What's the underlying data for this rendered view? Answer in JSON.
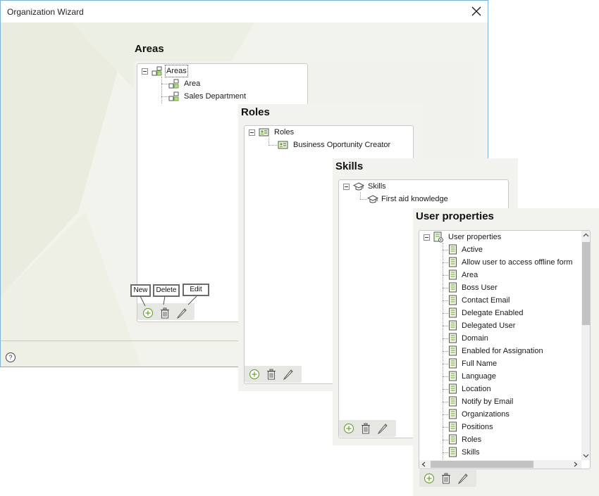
{
  "window": {
    "title": "Organization Wizard"
  },
  "areas": {
    "title": "Areas",
    "tree": {
      "root": "Areas",
      "children": [
        "Area",
        "Sales Department"
      ]
    }
  },
  "roles": {
    "title": "Roles",
    "tree": {
      "root": "Roles",
      "children": [
        "Business Oportunity Creator"
      ]
    }
  },
  "skills": {
    "title": "Skills",
    "tree": {
      "root": "Skills",
      "children": [
        "First aid knowledge"
      ]
    }
  },
  "user_properties": {
    "title": "User properties",
    "tree": {
      "root": "User properties",
      "children": [
        "Active",
        "Allow user to access offline form",
        "Area",
        "Boss User",
        "Contact Email",
        "Delegate Enabled",
        "Delegated User",
        "Domain",
        "Enabled for Assignation",
        "Full Name",
        "Language",
        "Location",
        "Notify by Email",
        "Organizations",
        "Positions",
        "Roles",
        "Skills"
      ]
    }
  },
  "callouts": {
    "new": "New",
    "delete": "Delete",
    "edit": "Edit"
  },
  "colors": {
    "accent_border": "#7fb0d8",
    "icon_green": "#6ea33a",
    "panel_bg": "#f2f3ef"
  }
}
